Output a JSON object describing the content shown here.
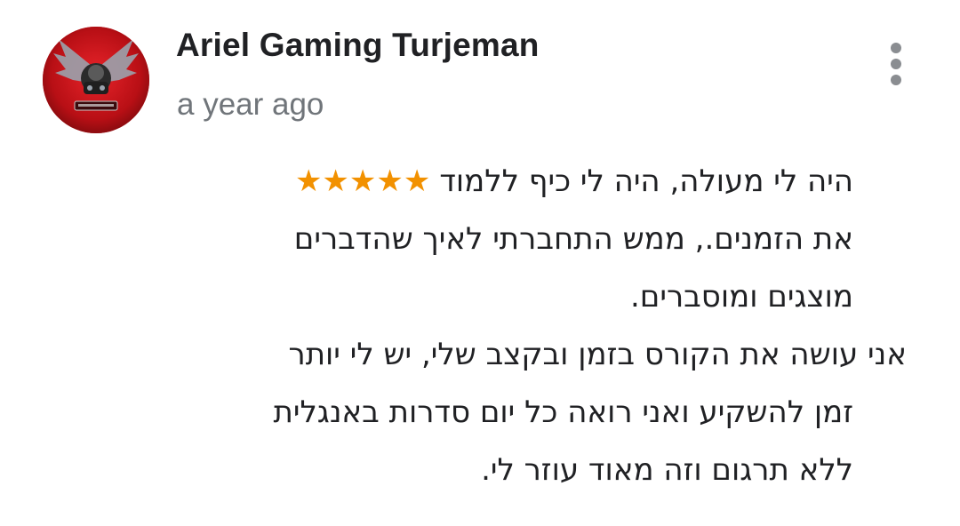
{
  "review": {
    "reviewer_name": "Ariel Gaming Turjeman",
    "time_ago": "a year ago",
    "rating": 5,
    "star_glyphs": "★★★★★",
    "lines": [
      "היה לי מעולה, היה לי כיף ללמוד",
      "את הזמנים.,  ממש התחברתי לאיך שהדברים",
      "מוצגים ומוסברים.",
      "אני עושה את הקורס בזמן ובקצב שלי, יש לי יותר",
      "זמן להשקיע ואני רואה כל יום סדרות באנגלית",
      "ללא תרגום וזה מאוד עוזר לי."
    ]
  },
  "colors": {
    "star": "#f29100",
    "name": "#202124",
    "time": "#70757a",
    "avatar_bg": "#c9141a"
  },
  "icons": {
    "avatar": "gaming-logo-avatar",
    "more": "more-vert-icon"
  }
}
